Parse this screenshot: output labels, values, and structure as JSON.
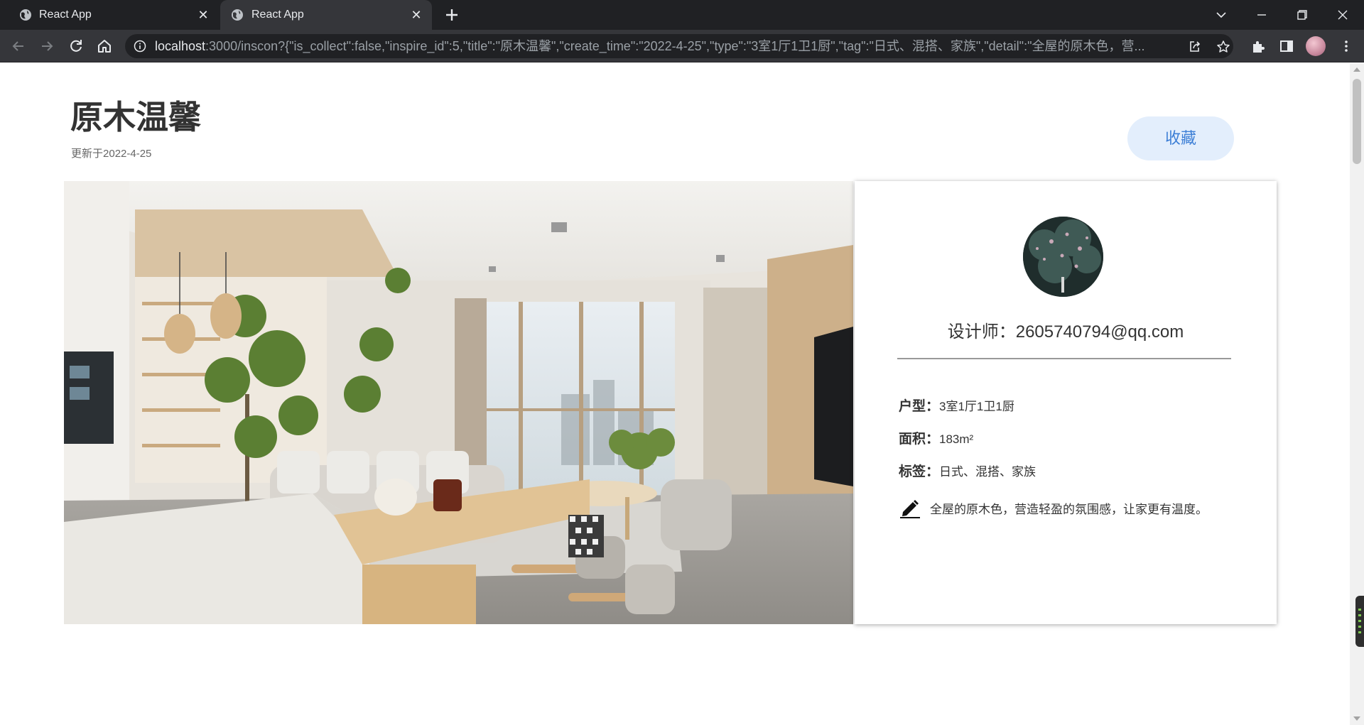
{
  "browser": {
    "tabs": [
      {
        "title": "React App",
        "active": false
      },
      {
        "title": "React App",
        "active": true
      }
    ],
    "address": {
      "host": "localhost",
      "rest": ":3000/inscon?{\"is_collect\":false,\"inspire_id\":5,\"title\":\"原木温馨\",\"create_time\":\"2022-4-25\",\"type\":\"3室1厅1卫1厨\",\"tag\":\"日式、混搭、家族\",\"detail\":\"全屋的原木色，营..."
    }
  },
  "page": {
    "title": "原木温馨",
    "updated_prefix": "更新于",
    "updated_date": "2022-4-25",
    "collect_label": "收藏",
    "designer_label": "设计师：",
    "designer_email": "2605740794@qq.com",
    "details": [
      {
        "key": "户型：",
        "value": "3室1厅1卫1厨"
      },
      {
        "key": "面积：",
        "value": "183m²"
      },
      {
        "key": "标签：",
        "value": "日式、混搭、家族"
      }
    ],
    "description": "全屋的原木色，营造轻盈的氛围感，让家更有温度。"
  },
  "colors": {
    "collect_bg": "#e3eefc",
    "collect_text": "#3d7fd6",
    "title_text": "#333333"
  },
  "icons": [
    "globe-icon",
    "close-icon",
    "plus-icon",
    "back-icon",
    "forward-icon",
    "reload-icon",
    "home-icon",
    "info-icon",
    "share-icon",
    "star-icon",
    "extensions-icon",
    "sidebar-icon",
    "menu-icon",
    "pen-icon"
  ]
}
